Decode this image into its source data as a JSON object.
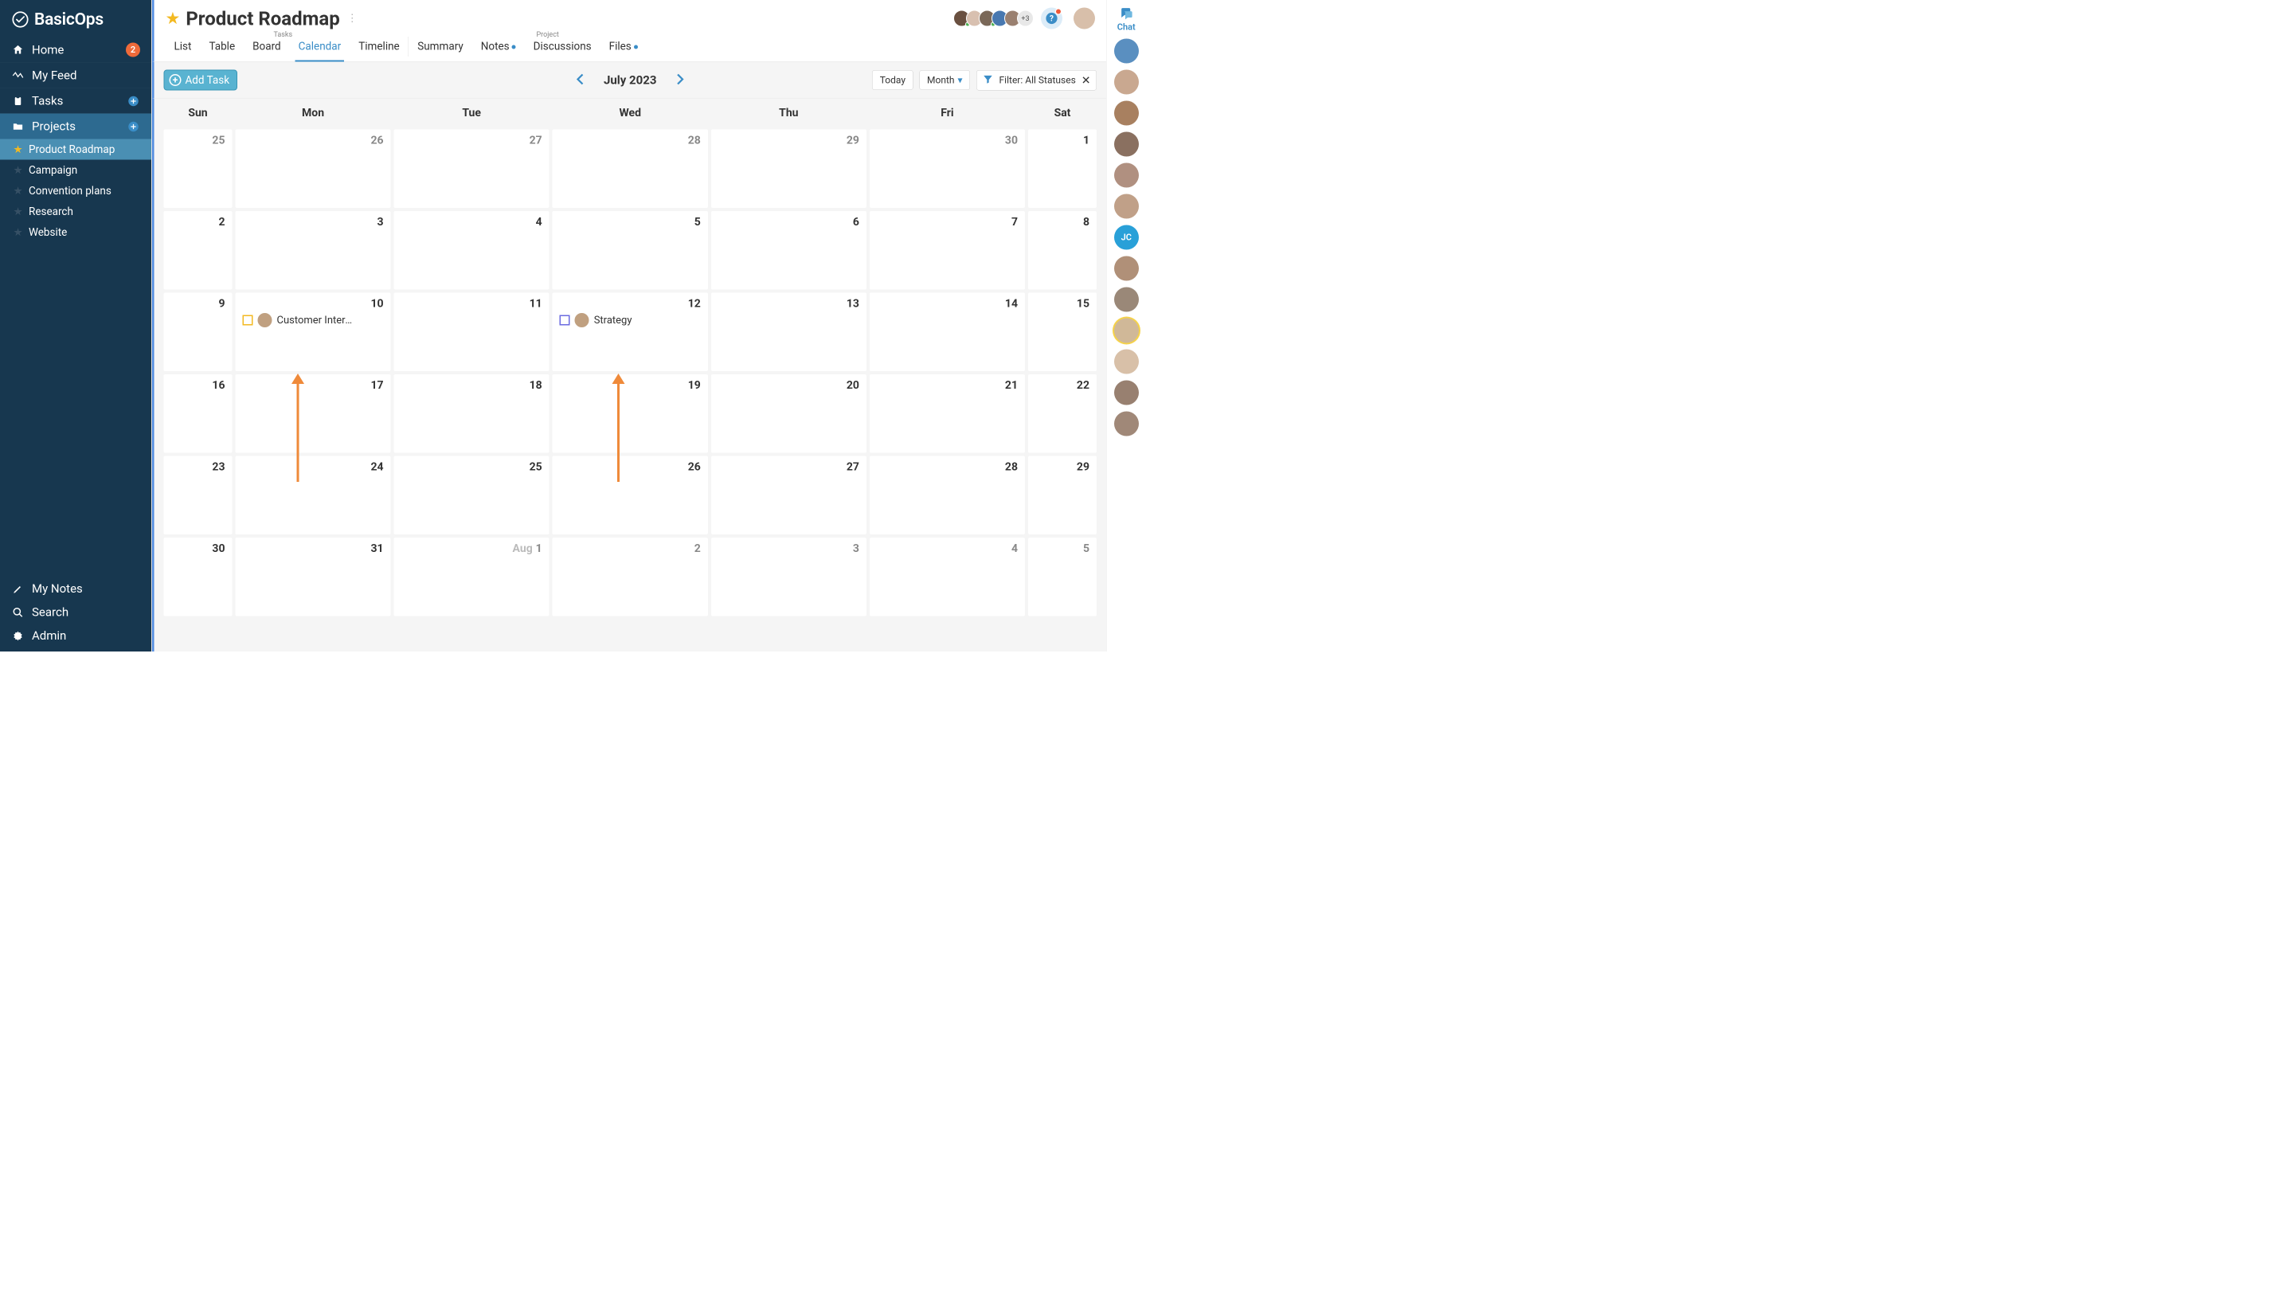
{
  "brand": "BasicOps",
  "sidebar": {
    "home": "Home",
    "home_badge": "2",
    "feed": "My Feed",
    "tasks": "Tasks",
    "projects": "Projects",
    "project_children": [
      {
        "label": "Product Roadmap",
        "starred": true,
        "active": true
      },
      {
        "label": "Campaign",
        "starred": false,
        "active": false
      },
      {
        "label": "Convention plans",
        "starred": false,
        "active": false
      },
      {
        "label": "Research",
        "starred": false,
        "active": false
      },
      {
        "label": "Website",
        "starred": false,
        "active": false
      }
    ],
    "mynotes": "My Notes",
    "search": "Search",
    "admin": "Admin"
  },
  "header": {
    "title": "Product Roadmap",
    "avatars_more": "+3"
  },
  "tabs": {
    "group_tasks": "Tasks",
    "group_project": "Project",
    "list": "List",
    "table": "Table",
    "board": "Board",
    "calendar": "Calendar",
    "timeline": "Timeline",
    "summary": "Summary",
    "notes": "Notes",
    "discussions": "Discussions",
    "files": "Files"
  },
  "toolbar": {
    "add_task": "Add Task",
    "month_label": "July 2023",
    "today": "Today",
    "view_mode": "Month",
    "filter_label": "Filter: All Statuses"
  },
  "calendar": {
    "days": [
      "Sun",
      "Mon",
      "Tue",
      "Wed",
      "Thu",
      "Fri",
      "Sat"
    ],
    "weeks": [
      [
        {
          "n": "25",
          "cur": false
        },
        {
          "n": "26",
          "cur": false
        },
        {
          "n": "27",
          "cur": false
        },
        {
          "n": "28",
          "cur": false
        },
        {
          "n": "29",
          "cur": false
        },
        {
          "n": "30",
          "cur": false
        },
        {
          "n": "1",
          "cur": true
        }
      ],
      [
        {
          "n": "2",
          "cur": true
        },
        {
          "n": "3",
          "cur": true
        },
        {
          "n": "4",
          "cur": true
        },
        {
          "n": "5",
          "cur": true
        },
        {
          "n": "6",
          "cur": true
        },
        {
          "n": "7",
          "cur": true
        },
        {
          "n": "8",
          "cur": true
        }
      ],
      [
        {
          "n": "9",
          "cur": true
        },
        {
          "n": "10",
          "cur": true,
          "task": {
            "label": "Customer Intera…",
            "color": "#f3b921"
          }
        },
        {
          "n": "11",
          "cur": true
        },
        {
          "n": "12",
          "cur": true,
          "task": {
            "label": "Strategy",
            "color": "#6b6be0"
          }
        },
        {
          "n": "13",
          "cur": true
        },
        {
          "n": "14",
          "cur": true
        },
        {
          "n": "15",
          "cur": true
        }
      ],
      [
        {
          "n": "16",
          "cur": true
        },
        {
          "n": "17",
          "cur": true
        },
        {
          "n": "18",
          "cur": true
        },
        {
          "n": "19",
          "cur": true
        },
        {
          "n": "20",
          "cur": true
        },
        {
          "n": "21",
          "cur": true
        },
        {
          "n": "22",
          "cur": true
        }
      ],
      [
        {
          "n": "23",
          "cur": true
        },
        {
          "n": "24",
          "cur": true
        },
        {
          "n": "25",
          "cur": true
        },
        {
          "n": "26",
          "cur": true
        },
        {
          "n": "27",
          "cur": true
        },
        {
          "n": "28",
          "cur": true
        },
        {
          "n": "29",
          "cur": true
        }
      ],
      [
        {
          "n": "30",
          "cur": true
        },
        {
          "n": "31",
          "cur": true
        },
        {
          "n": "1",
          "cur": false,
          "prefix": "Aug"
        },
        {
          "n": "2",
          "cur": false
        },
        {
          "n": "3",
          "cur": false
        },
        {
          "n": "4",
          "cur": false
        },
        {
          "n": "5",
          "cur": false
        }
      ]
    ]
  },
  "chat": {
    "label": "Chat",
    "contacts": [
      {
        "initials": "",
        "bg": "#5a8fc0"
      },
      {
        "initials": "",
        "bg": "#c9a890"
      },
      {
        "initials": "",
        "bg": "#a88060"
      },
      {
        "initials": "",
        "bg": "#8a7060"
      },
      {
        "initials": "",
        "bg": "#b09080"
      },
      {
        "initials": "",
        "bg": "#c0a088"
      },
      {
        "initials": "JC",
        "bg": "#29a0d8",
        "jc": true
      },
      {
        "initials": "",
        "bg": "#b09078"
      },
      {
        "initials": "",
        "bg": "#9a8878"
      },
      {
        "initials": "",
        "bg": "#d0b898",
        "highlight": true
      },
      {
        "initials": "",
        "bg": "#d8c0a8"
      },
      {
        "initials": "",
        "bg": "#988070"
      },
      {
        "initials": "",
        "bg": "#a08878"
      }
    ]
  }
}
